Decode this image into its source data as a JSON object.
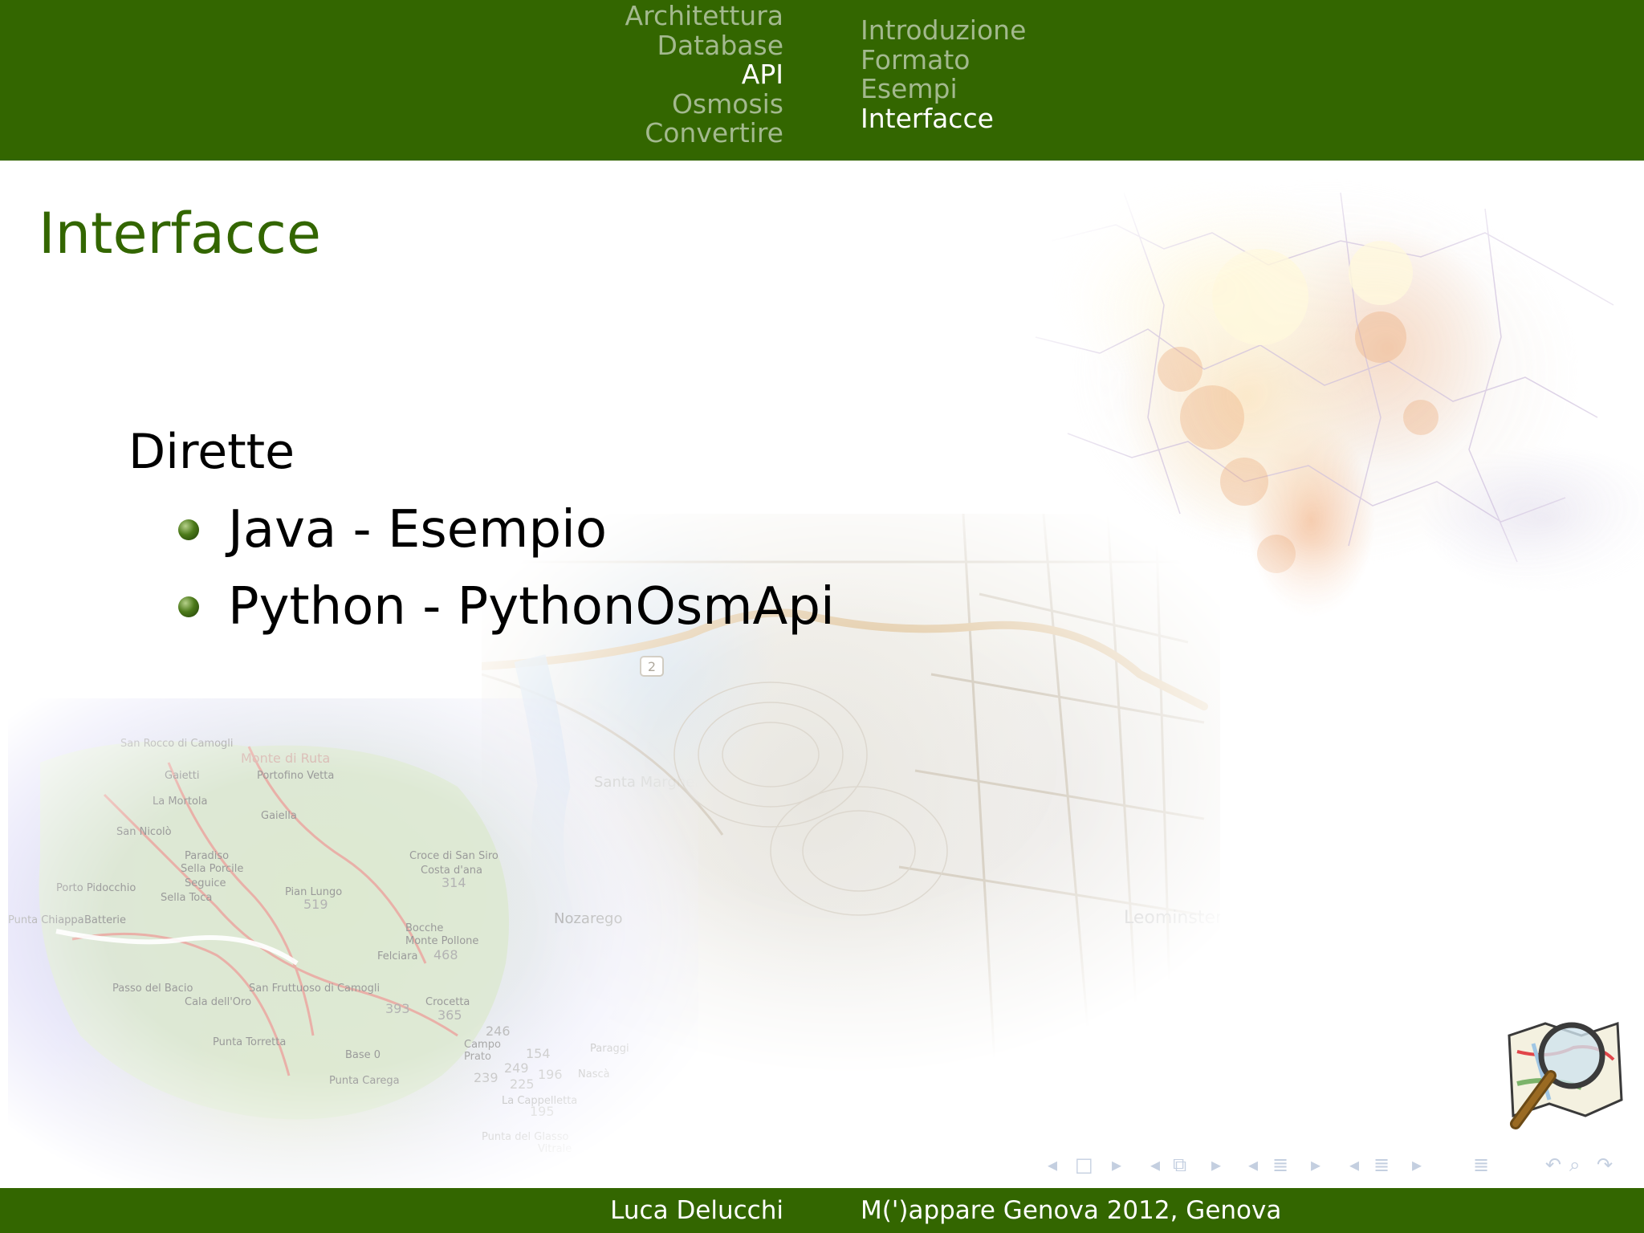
{
  "header": {
    "sections": [
      {
        "label": "Architettura",
        "active": false
      },
      {
        "label": "Database",
        "active": false
      },
      {
        "label": "API",
        "active": true
      },
      {
        "label": "Osmosis",
        "active": false
      },
      {
        "label": "Convertire",
        "active": false
      }
    ],
    "subsections": [
      {
        "label": "Introduzione",
        "active": false
      },
      {
        "label": "Formato",
        "active": false
      },
      {
        "label": "Esempi",
        "active": false
      },
      {
        "label": "Interfacce",
        "active": true
      }
    ]
  },
  "frame": {
    "title": "Interfacce",
    "block_heading": "Dirette",
    "bullets": [
      {
        "text": "Java - Esempio"
      },
      {
        "text": "Python - PythonOsmApi"
      }
    ]
  },
  "maps": {
    "coast_labels": [
      "San Rocco di Camogli",
      "Monte di Ruta",
      "Portofino Vetta",
      "Gaiella",
      "Santa Margherita Ligure",
      "Nozarego",
      "Croce di San Siro",
      "Costa d'ana",
      "Pian Lungo",
      "Bocche",
      "Monte Pollone",
      "Felciara",
      "Paraggi",
      "Punta Carega",
      "Punta Torretta",
      "San Fruttuoso di Camogli",
      "Passo del Bacio",
      "Cala dell'Oro",
      "Punta del Glasso",
      "La Cappelletta",
      "Punta Chiappa",
      "Batterie",
      "Porto Pidocchio",
      "Paradiso",
      "Sella Porcile",
      "Seguice",
      "Sella Toca",
      "San Nicolò",
      "La Mortola",
      "Gaietti",
      "Nascà",
      "Crocetta",
      "Campo",
      "Prato",
      "Base 0",
      "Vitrale"
    ],
    "coast_numbers": [
      "314",
      "519",
      "468",
      "393",
      "365",
      "246",
      "154",
      "249",
      "196",
      "225",
      "239",
      "195"
    ],
    "city_label": "Leominster",
    "road_shield": "2"
  },
  "nav_symbols": [
    "◂",
    "□",
    "▸",
    "◂",
    "⧉",
    "▸",
    "◂",
    "≣",
    "▸",
    "◂",
    "≣",
    "▸",
    "≣",
    "↶",
    "⌕",
    "↷"
  ],
  "footer": {
    "author": "Luca Delucchi",
    "talk": "M(')appare Genova 2012, Genova"
  },
  "colors": {
    "theme_green": "#336600",
    "inactive_nav": "#a3b98e",
    "title_green": "#336600"
  }
}
